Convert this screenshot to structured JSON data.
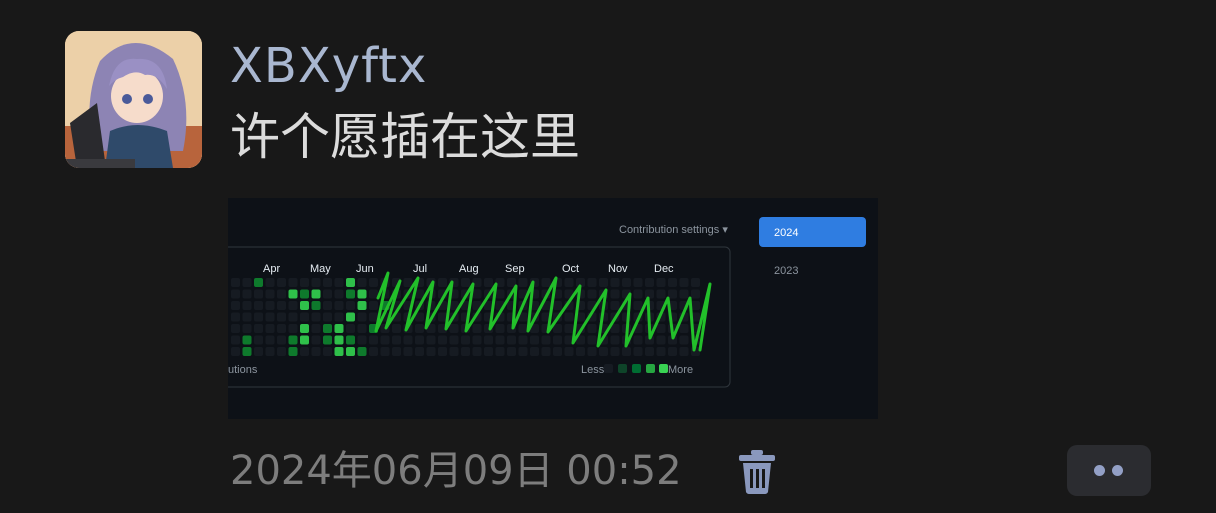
{
  "post": {
    "username": "XBXyftx",
    "text": "许个愿插在这里",
    "timestamp": "2024年06月09日 00:52"
  },
  "screenshot": {
    "settings_label": "Contribution settings ▾",
    "years": [
      "2024",
      "2023"
    ],
    "selected_year": "2024",
    "months": [
      "Apr",
      "May",
      "Jun",
      "Jul",
      "Aug",
      "Sep",
      "Oct",
      "Nov",
      "Dec"
    ],
    "contributions_fragment": "utions",
    "legend_less": "Less",
    "legend_more": "More"
  },
  "colors": {
    "background": "#181818",
    "username": "#a9b7d0",
    "accent_blue": "#2f7de1",
    "green_light": "#39d353",
    "green_dark": "#0e4429"
  },
  "icons": {
    "delete": "trash-icon",
    "more": "more-dots-icon"
  }
}
